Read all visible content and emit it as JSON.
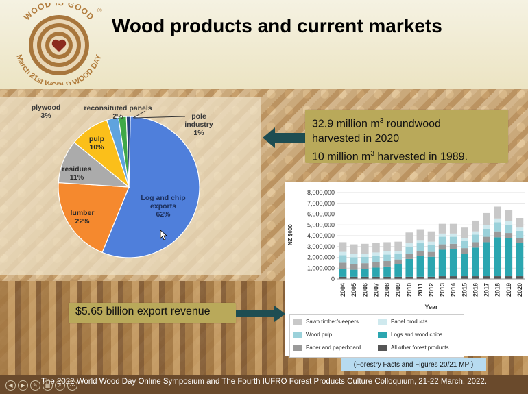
{
  "header": {
    "title": "Wood products and current markets",
    "logo": {
      "top_text": "WOOD IS GOOD",
      "bottom_text": "March 21st WORLD WOOD DAY",
      "reg_mark": "®"
    }
  },
  "harvest_callout": {
    "line1_pre": "32.9 million m",
    "line1_sup": "3",
    "line1_post": " roundwood",
    "line2": "harvested in 2020",
    "line3_pre": "10 million m",
    "line3_sup": "3",
    "line3_post": " harvested  in 1989."
  },
  "revenue_callout": {
    "text": "$5.65 billion export revenue"
  },
  "source": {
    "text": "(Forestry Facts and Figures 20/21 MPI)"
  },
  "footer": {
    "text": "The 2022 World Wood Day Online Symposium and The Fourth IUFRO Forest Products Culture Colloquium, 21-22 March, 2022."
  },
  "colors": {
    "footer_bg": "#6a4a2c",
    "callout_bg": "#b9a95a",
    "teal": "#2ba6b0"
  },
  "chart_data": [
    {
      "type": "pie",
      "slices": [
        {
          "name": "Log and chip exports",
          "label_lines": [
            "Log and chip",
            "exports"
          ],
          "pct_label": "62%",
          "value": 62,
          "color": "#4f7fdb"
        },
        {
          "name": "lumber",
          "label_lines": [
            "lumber"
          ],
          "pct_label": "22%",
          "value": 22,
          "color": "#f5892e"
        },
        {
          "name": "residues",
          "label_lines": [
            "residues"
          ],
          "pct_label": "11%",
          "value": 11,
          "color": "#ababab"
        },
        {
          "name": "pulp",
          "label_lines": [
            "pulp"
          ],
          "pct_label": "10%",
          "value": 10,
          "color": "#fbbf1a"
        },
        {
          "name": "plywood",
          "label_lines": [
            "plywood"
          ],
          "pct_label": "3%",
          "value": 3,
          "color": "#5fa3de"
        },
        {
          "name": "reconsituted panels",
          "label_lines": [
            "reconsituted panels"
          ],
          "pct_label": "2%",
          "value": 2,
          "color": "#3fa847"
        },
        {
          "name": "pole industry",
          "label_lines": [
            "pole",
            "industry"
          ],
          "pct_label": "1%",
          "value": 1,
          "color": "#27417c"
        }
      ]
    },
    {
      "type": "bar",
      "stacked": true,
      "xlabel": "Year",
      "ylabel": "NZ $000",
      "ylim": [
        0,
        8000000
      ],
      "yticks": [
        "0",
        "1,000,000",
        "2,000,000",
        "3,000,000",
        "4,000,000",
        "5,000,000",
        "6,000,000",
        "7,000,000",
        "8,000,000"
      ],
      "grid": true,
      "categories": [
        "2004",
        "2005",
        "2006",
        "2007",
        "2008",
        "2009",
        "2010",
        "2011",
        "2012",
        "2013",
        "2014",
        "2015",
        "2016",
        "2017",
        "2018",
        "2019",
        "2020"
      ],
      "series": [
        {
          "name": "All other forest products",
          "color": "#555555",
          "values": [
            200000,
            200000,
            200000,
            200000,
            200000,
            200000,
            200000,
            200000,
            200000,
            250000,
            250000,
            250000,
            250000,
            250000,
            250000,
            250000,
            250000
          ]
        },
        {
          "name": "Logs and wood chips",
          "color": "#2ba6b0",
          "values": [
            750000,
            650000,
            750000,
            850000,
            950000,
            1150000,
            1650000,
            1900000,
            1850000,
            2450000,
            2500000,
            2100000,
            2650000,
            3150000,
            3600000,
            3500000,
            3100000
          ]
        },
        {
          "name": "Paper and paperboard",
          "color": "#9a9a9a",
          "values": [
            550000,
            500000,
            500000,
            500000,
            500000,
            450000,
            500000,
            500000,
            450000,
            500000,
            500000,
            500000,
            500000,
            500000,
            550000,
            500000,
            450000
          ]
        },
        {
          "name": "Wood pulp",
          "color": "#9bd1da",
          "values": [
            700000,
            650000,
            600000,
            600000,
            600000,
            550000,
            650000,
            700000,
            650000,
            700000,
            650000,
            650000,
            700000,
            750000,
            850000,
            750000,
            650000
          ]
        },
        {
          "name": "Panel products",
          "color": "#cfe9ee",
          "values": [
            300000,
            300000,
            300000,
            300000,
            300000,
            250000,
            300000,
            300000,
            300000,
            300000,
            300000,
            300000,
            300000,
            350000,
            350000,
            350000,
            300000
          ]
        },
        {
          "name": "Sawn timber/sleepers",
          "color": "#c8c8c8",
          "values": [
            900000,
            900000,
            900000,
            900000,
            850000,
            850000,
            1000000,
            1000000,
            950000,
            900000,
            900000,
            950000,
            1000000,
            1100000,
            1100000,
            1000000,
            900000
          ]
        }
      ],
      "legend_order": [
        "Sawn timber/sleepers",
        "Panel products",
        "Wood pulp",
        "Logs and wood chips",
        "Paper and paperboard",
        "All other forest products"
      ]
    }
  ]
}
